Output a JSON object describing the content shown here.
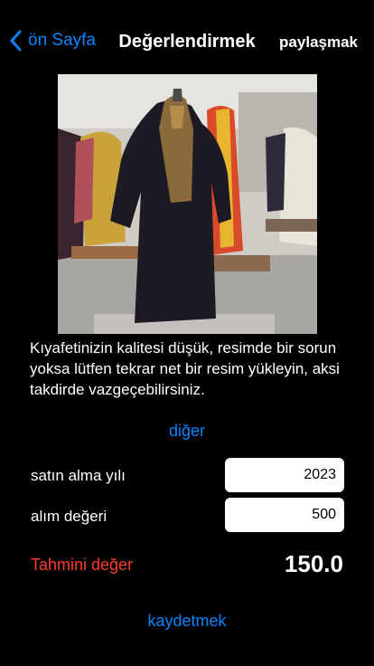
{
  "navbar": {
    "back_label": "ön Sayfa",
    "title": "Değerlendirmek",
    "share_label": "paylaşmak"
  },
  "message": "Kıyafetinizin kalitesi düşük, resimde bir sorun yoksa lütfen tekrar net bir resim yükleyin, aksi takdirde vazgeçebilirsiniz.",
  "other_label": "diğer",
  "form": {
    "purchase_year_label": "satın alma yılı",
    "purchase_year_value": "2023",
    "purchase_value_label": "alım değeri",
    "purchase_value_value": "500"
  },
  "estimate": {
    "label": "Tahmini değer",
    "value": "150.0"
  },
  "save_label": "kaydetmek",
  "colors": {
    "accent": "#0a84ff",
    "estimate_label": "#ff3b30",
    "background": "#000000"
  }
}
